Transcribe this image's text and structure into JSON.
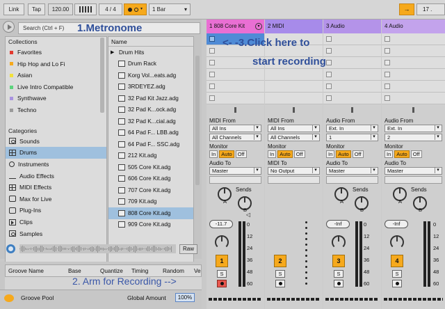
{
  "transport": {
    "link": "Link",
    "tap": "Tap",
    "tempo": "120.00",
    "signature": "4 / 4",
    "quantize": "1 Bar",
    "position": "17 ."
  },
  "browser": {
    "search_placeholder": "Search (Ctrl + F)",
    "collections_title": "Collections",
    "collections": [
      {
        "label": "Favorites",
        "color": "#e23a2f"
      },
      {
        "label": "Hip Hop and Lo Fi",
        "color": "#f6a91c"
      },
      {
        "label": "Asian",
        "color": "#f2e13a"
      },
      {
        "label": "Live Intro Compatible",
        "color": "#5cd37c"
      },
      {
        "label": "Synthwave",
        "color": "#a993e0"
      },
      {
        "label": "Techno",
        "color": "#9a9a9a"
      }
    ],
    "categories_title": "Categories",
    "categories": [
      {
        "label": "Sounds",
        "icon": "speaker-icon"
      },
      {
        "label": "Drums",
        "icon": "drum-grid-icon"
      },
      {
        "label": "Instruments",
        "icon": "note-icon"
      },
      {
        "label": "Audio Effects",
        "icon": "wave-icon"
      },
      {
        "label": "MIDI Effects",
        "icon": "midi-icon"
      },
      {
        "label": "Max for Live",
        "icon": "max-icon"
      },
      {
        "label": "Plug-Ins",
        "icon": "plugin-icon"
      },
      {
        "label": "Clips",
        "icon": "clip-icon"
      },
      {
        "label": "Samples",
        "icon": "sample-icon"
      }
    ],
    "files_header": "Name",
    "folder": "Drum Hits",
    "files": [
      "Drum Rack",
      "Korg Vol...eats.adg",
      "3RDEYEZ.adg",
      "32 Pad Kit Jazz.adg",
      "32 Pad K...ock.adg",
      "32 Pad K...cial.adg",
      "64 Pad F... LBB.adg",
      "64 Pad F... SSC.adg",
      "212 Kit.adg",
      "505 Core Kit.adg",
      "606 Core Kit.adg",
      "707 Core Kit.adg",
      "709 Kit.adg",
      "808 Core Kit.adg",
      "909 Core Kit.adg"
    ],
    "selected_file_index": 13,
    "raw": "Raw"
  },
  "groove": {
    "cols": [
      "Groove Name",
      "Base",
      "Quantize",
      "Timing",
      "Random",
      "Ve"
    ],
    "pool_label": "Groove Pool",
    "global_amount_label": "Global Amount",
    "global_amount": "100%"
  },
  "tracks": [
    {
      "name": "1 808 Core Kit",
      "color": "#e96fd3",
      "type": "midi",
      "from_label": "MIDI From",
      "from": "All Ins",
      "channel": "All Channels",
      "to": "Master",
      "volume": "-11.7",
      "number": "1",
      "armed": true
    },
    {
      "name": "2 MIDI",
      "color": "#a78bea",
      "type": "midi",
      "from_label": "MIDI From",
      "from": "All Ins",
      "channel": "All Channels",
      "to_label": "MIDI To",
      "to": "No Output",
      "volume": "",
      "number": "2",
      "armed": false
    },
    {
      "name": "3 Audio",
      "color": "#b493e9",
      "type": "audio",
      "from_label": "Audio From",
      "from": "Ext. In",
      "channel": "1",
      "to": "Master",
      "volume": "-Inf",
      "number": "3",
      "armed": false
    },
    {
      "name": "4 Audio",
      "color": "#c3a3ec",
      "type": "audio",
      "from_label": "Audio From",
      "from": "Ext. In",
      "channel": "2",
      "to": "Master",
      "volume": "-Inf",
      "number": "4",
      "armed": false
    }
  ],
  "mixer_labels": {
    "monitor": "Monitor",
    "in": "In",
    "auto": "Auto",
    "off": "Off",
    "audio_to": "Audio To",
    "sends": "Sends",
    "send_a": "A",
    "send_b": "B",
    "solo": "S"
  },
  "meter_scale": [
    "0",
    "12",
    "24",
    "36",
    "48",
    "60"
  ],
  "annotations": {
    "metronome": "1.Metronome",
    "arm": "2. Arm for Recording -->",
    "click_line1": "<- -3.Click here to",
    "click_line2": "start recording"
  }
}
